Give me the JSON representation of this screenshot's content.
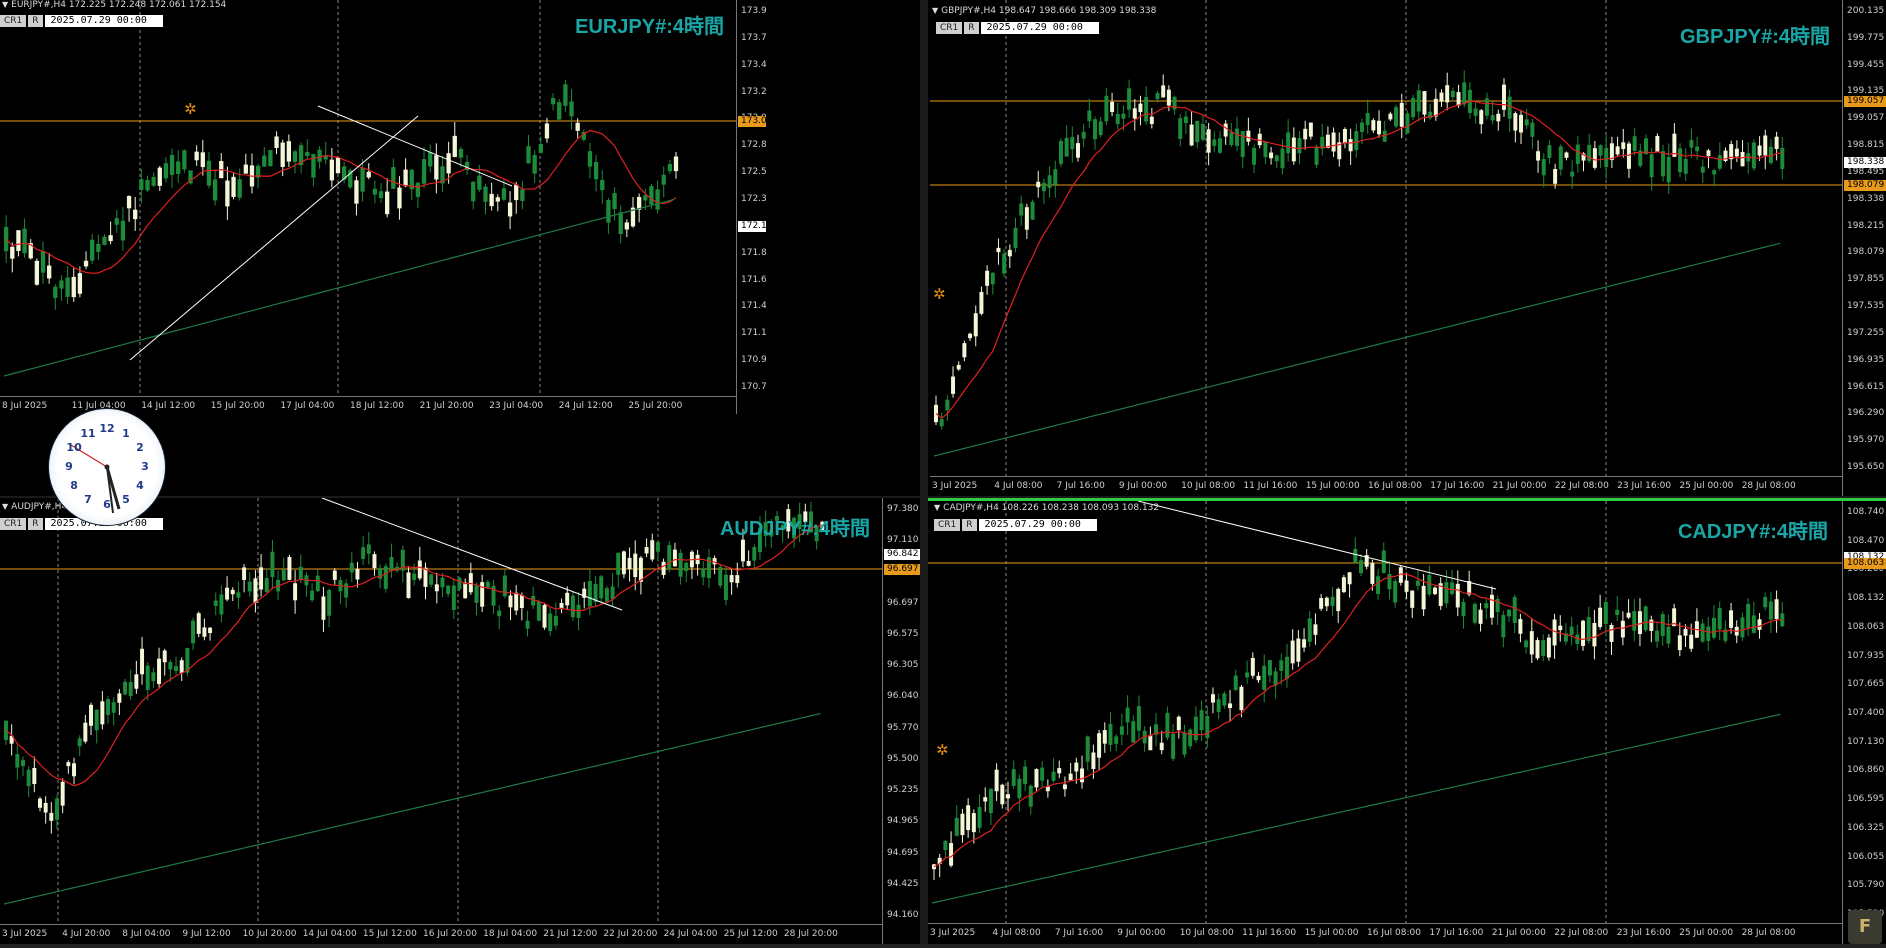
{
  "colors": {
    "bull": "#1c8c3a",
    "bear": "#f4f6d8",
    "ma_short": "#e02020",
    "ma_long": "#1f7a46",
    "hline": "#e89a1a",
    "trend": "#ffffff",
    "grid": "#8a8a8a",
    "title": "#1aa6a6"
  },
  "icons": {
    "expert": "gear-icon",
    "clock": "analog-clock",
    "tab_arrow": "triangle-down-icon"
  },
  "charts": [
    {
      "id": "eurjpy",
      "title": "EURJPY#:4時間",
      "header": "EURJPY#,H4  172.225 172.248 172.061 172.154",
      "tag1": "CR1",
      "tag2": "R",
      "date": "2025.07.29 00:00",
      "ylabels": [
        "173.955",
        "173.725",
        "173.495",
        "173.265",
        "173.025",
        "172.805",
        "172.575",
        "172.345",
        "172.154",
        "171.885",
        "171.655",
        "171.425",
        "171.195",
        "170.965",
        "170.735"
      ],
      "xlabels": [
        "8 Jul 2025",
        "11 Jul 04:00",
        "14 Jul 12:00",
        "15 Jul 20:00",
        "17 Jul 04:00",
        "18 Jul 12:00",
        "21 Jul 20:00",
        "23 Jul 04:00",
        "24 Jul 12:00",
        "25 Jul 20:00"
      ],
      "price_badges": [
        {
          "text": "173.025",
          "type": "hline"
        },
        {
          "text": "172.154",
          "type": "current"
        }
      ]
    },
    {
      "id": "gbpjpy",
      "title": "GBPJPY#:4時間",
      "header": "GBPJPY#,H4  198.647 198.666 198.309 198.338",
      "tag1": "CR1",
      "tag2": "R",
      "date": "2025.07.29 00:00",
      "ylabels": [
        "200.135",
        "199.775",
        "199.455",
        "199.135",
        "199.057",
        "198.815",
        "198.495",
        "198.338",
        "198.215",
        "198.079",
        "197.855",
        "197.535",
        "197.255",
        "196.935",
        "196.615",
        "196.290",
        "195.970",
        "195.650"
      ],
      "xlabels": [
        "3 Jul 2025",
        "4 Jul 08:00",
        "7 Jul 16:00",
        "9 Jul 00:00",
        "10 Jul 08:00",
        "11 Jul 16:00",
        "15 Jul 00:00",
        "16 Jul 08:00",
        "17 Jul 16:00",
        "21 Jul 00:00",
        "22 Jul 08:00",
        "23 Jul 16:00",
        "25 Jul 00:00",
        "28 Jul 08:00"
      ],
      "price_badges": [
        {
          "text": "199.057",
          "type": "hline"
        },
        {
          "text": "198.338",
          "type": "current"
        },
        {
          "text": "198.079",
          "type": "hline"
        }
      ]
    },
    {
      "id": "audjpy",
      "title": "AUDJPY#:4時間",
      "header": "AUDJPY#,H4  96.674 96.842",
      "tag1": "CR1",
      "tag2": "R",
      "date": "2025.07.29 00:00",
      "ylabels": [
        "97.380",
        "97.110",
        "96.842",
        "96.697",
        "96.575",
        "96.305",
        "96.040",
        "95.770",
        "95.500",
        "95.235",
        "94.965",
        "94.695",
        "94.425",
        "94.160"
      ],
      "xlabels": [
        "3 Jul 2025",
        "4 Jul 20:00",
        "8 Jul 04:00",
        "9 Jul 12:00",
        "10 Jul 20:00",
        "14 Jul 04:00",
        "15 Jul 12:00",
        "16 Jul 20:00",
        "18 Jul 04:00",
        "21 Jul 12:00",
        "22 Jul 20:00",
        "24 Jul 04:00",
        "25 Jul 12:00",
        "28 Jul 20:00"
      ],
      "price_badges": [
        {
          "text": "96.842",
          "type": "current"
        },
        {
          "text": "96.697",
          "type": "hline"
        }
      ]
    },
    {
      "id": "cadjpy",
      "title": "CADJPY#:4時間",
      "header": "CADJPY#,H4  108.226 108.238 108.093 108.132",
      "tag1": "CR1",
      "tag2": "R",
      "date": "2025.07.29 00:00",
      "ylabels": [
        "108.740",
        "108.470",
        "108.200",
        "108.132",
        "108.063",
        "107.935",
        "107.665",
        "107.400",
        "107.130",
        "106.860",
        "106.595",
        "106.325",
        "106.055",
        "105.790",
        "105.520"
      ],
      "xlabels": [
        "3 Jul 2025",
        "4 Jul 08:00",
        "7 Jul 16:00",
        "9 Jul 00:00",
        "10 Jul 08:00",
        "11 Jul 16:00",
        "15 Jul 00:00",
        "16 Jul 08:00",
        "17 Jul 16:00",
        "21 Jul 00:00",
        "22 Jul 08:00",
        "23 Jul 16:00",
        "25 Jul 00:00",
        "28 Jul 08:00"
      ],
      "price_badges": [
        {
          "text": "108.132",
          "type": "current"
        },
        {
          "text": "108.063",
          "type": "hline"
        }
      ]
    }
  ],
  "clock": {
    "numbers": [
      "12",
      "1",
      "2",
      "3",
      "4",
      "5",
      "6",
      "7",
      "8",
      "9",
      "10",
      "11"
    ]
  },
  "logo_text": "F"
}
